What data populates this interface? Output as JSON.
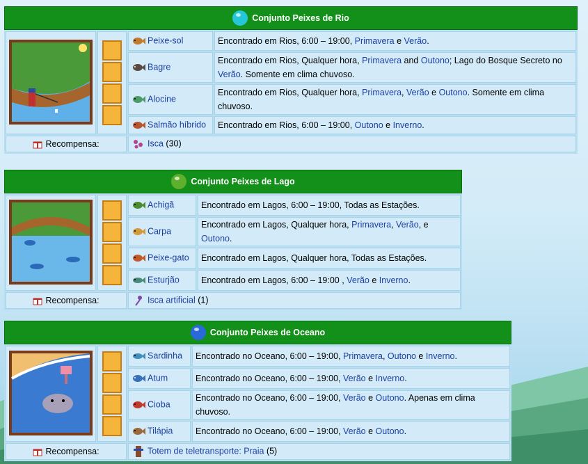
{
  "bundles": [
    {
      "title": "Conjunto Peixes de Rio",
      "gem_color": "#26c6da",
      "fish": [
        {
          "name": "Peixe-sol",
          "color": "#c27a2c",
          "desc": [
            {
              "t": "Encontrado em Rios, 6:00 – 19:00, "
            },
            {
              "t": "Primavera",
              "l": 1
            },
            {
              "t": " e "
            },
            {
              "t": "Verão",
              "l": 1
            },
            {
              "t": "."
            }
          ]
        },
        {
          "name": "Bagre",
          "color": "#5a4a46",
          "desc": [
            {
              "t": "Encontrado em Rios, Qualquer hora, "
            },
            {
              "t": "Primavera",
              "l": 1
            },
            {
              "t": " and "
            },
            {
              "t": "Outono",
              "l": 1
            },
            {
              "t": "; Lago do Bosque Secreto no "
            },
            {
              "t": "Verão",
              "l": 1
            },
            {
              "t": ". Somente em clima chuvoso."
            }
          ]
        },
        {
          "name": "Alocine",
          "color": "#4f9a6a",
          "desc": [
            {
              "t": "Encontrado em Rios, Qualquer hora, "
            },
            {
              "t": "Primavera",
              "l": 1
            },
            {
              "t": ", "
            },
            {
              "t": "Verão",
              "l": 1
            },
            {
              "t": " e "
            },
            {
              "t": "Outono",
              "l": 1
            },
            {
              "t": ". Somente em clima chuvoso."
            }
          ]
        },
        {
          "name": "Salmão híbrido",
          "color": "#b8542e",
          "desc": [
            {
              "t": "Encontrado em Rios, 6:00 – 19:00, "
            },
            {
              "t": "Outono",
              "l": 1
            },
            {
              "t": " e "
            },
            {
              "t": "Inverno",
              "l": 1
            },
            {
              "t": "."
            }
          ]
        }
      ],
      "reward_label": "Recompensa:",
      "reward_item": "Isca",
      "reward_qty": "(30)",
      "reward_color": "#b0448e"
    },
    {
      "title": "Conjunto Peixes de Lago",
      "gem_color": "#5fb02c",
      "fish": [
        {
          "name": "Achigã",
          "color": "#4a8d2e",
          "desc": [
            {
              "t": "Encontrado em Lagos, 6:00 – 19:00, Todas as Estações."
            }
          ]
        },
        {
          "name": "Carpa",
          "color": "#d29a3c",
          "desc": [
            {
              "t": "Encontrado em Lagos, Qualquer hora, "
            },
            {
              "t": "Primavera",
              "l": 1
            },
            {
              "t": ", "
            },
            {
              "t": "Verão",
              "l": 1
            },
            {
              "t": ", e "
            },
            {
              "t": "Outono",
              "l": 1
            },
            {
              "t": "."
            }
          ]
        },
        {
          "name": "Peixe-gato",
          "color": "#c25a28",
          "desc": [
            {
              "t": "Encontrado em Lagos, Qualquer hora, Todas as Estações."
            }
          ]
        },
        {
          "name": "Esturjão",
          "color": "#4a8a7a",
          "desc": [
            {
              "t": "Encontrado em Lagos, 6:00 – 19:00 , "
            },
            {
              "t": "Verão",
              "l": 1
            },
            {
              "t": " e "
            },
            {
              "t": "Inverno",
              "l": 1
            },
            {
              "t": "."
            }
          ]
        }
      ],
      "reward_label": "Recompensa:",
      "reward_item": "Isca artificial",
      "reward_qty": "(1)",
      "reward_color": "#7a4aa8"
    },
    {
      "title": "Conjunto Peixes de Oceano",
      "gem_color": "#2a6ad8",
      "fish": [
        {
          "name": "Sardinha",
          "color": "#3f8fb8",
          "desc": [
            {
              "t": "Encontrado no Oceano, 6:00 – 19:00, "
            },
            {
              "t": "Primavera",
              "l": 1
            },
            {
              "t": ", "
            },
            {
              "t": "Outono",
              "l": 1
            },
            {
              "t": " e "
            },
            {
              "t": "Inverno",
              "l": 1
            },
            {
              "t": "."
            }
          ]
        },
        {
          "name": "Atum",
          "color": "#3a70b8",
          "desc": [
            {
              "t": "Encontrado no Oceano, 6:00 – 19:00, "
            },
            {
              "t": "Verão",
              "l": 1
            },
            {
              "t": " e "
            },
            {
              "t": "Inverno",
              "l": 1
            },
            {
              "t": "."
            }
          ]
        },
        {
          "name": "Cioba",
          "color": "#c23a2e",
          "desc": [
            {
              "t": "Encontrado no Oceano, 6:00 – 19:00, "
            },
            {
              "t": "Verão",
              "l": 1
            },
            {
              "t": " e "
            },
            {
              "t": "Outono",
              "l": 1
            },
            {
              "t": ". Apenas em clima chuvoso."
            }
          ]
        },
        {
          "name": "Tilápia",
          "color": "#9a6a3a",
          "desc": [
            {
              "t": "Encontrado no Oceano, 6:00 – 19:00, "
            },
            {
              "t": "Verão",
              "l": 1
            },
            {
              "t": " e "
            },
            {
              "t": "Outono",
              "l": 1
            },
            {
              "t": "."
            }
          ]
        }
      ],
      "reward_label": "Recompensa:",
      "reward_item": "Totem de teletransporte: Praia",
      "reward_qty": "(5)",
      "reward_color": "#8a4a2a"
    }
  ]
}
